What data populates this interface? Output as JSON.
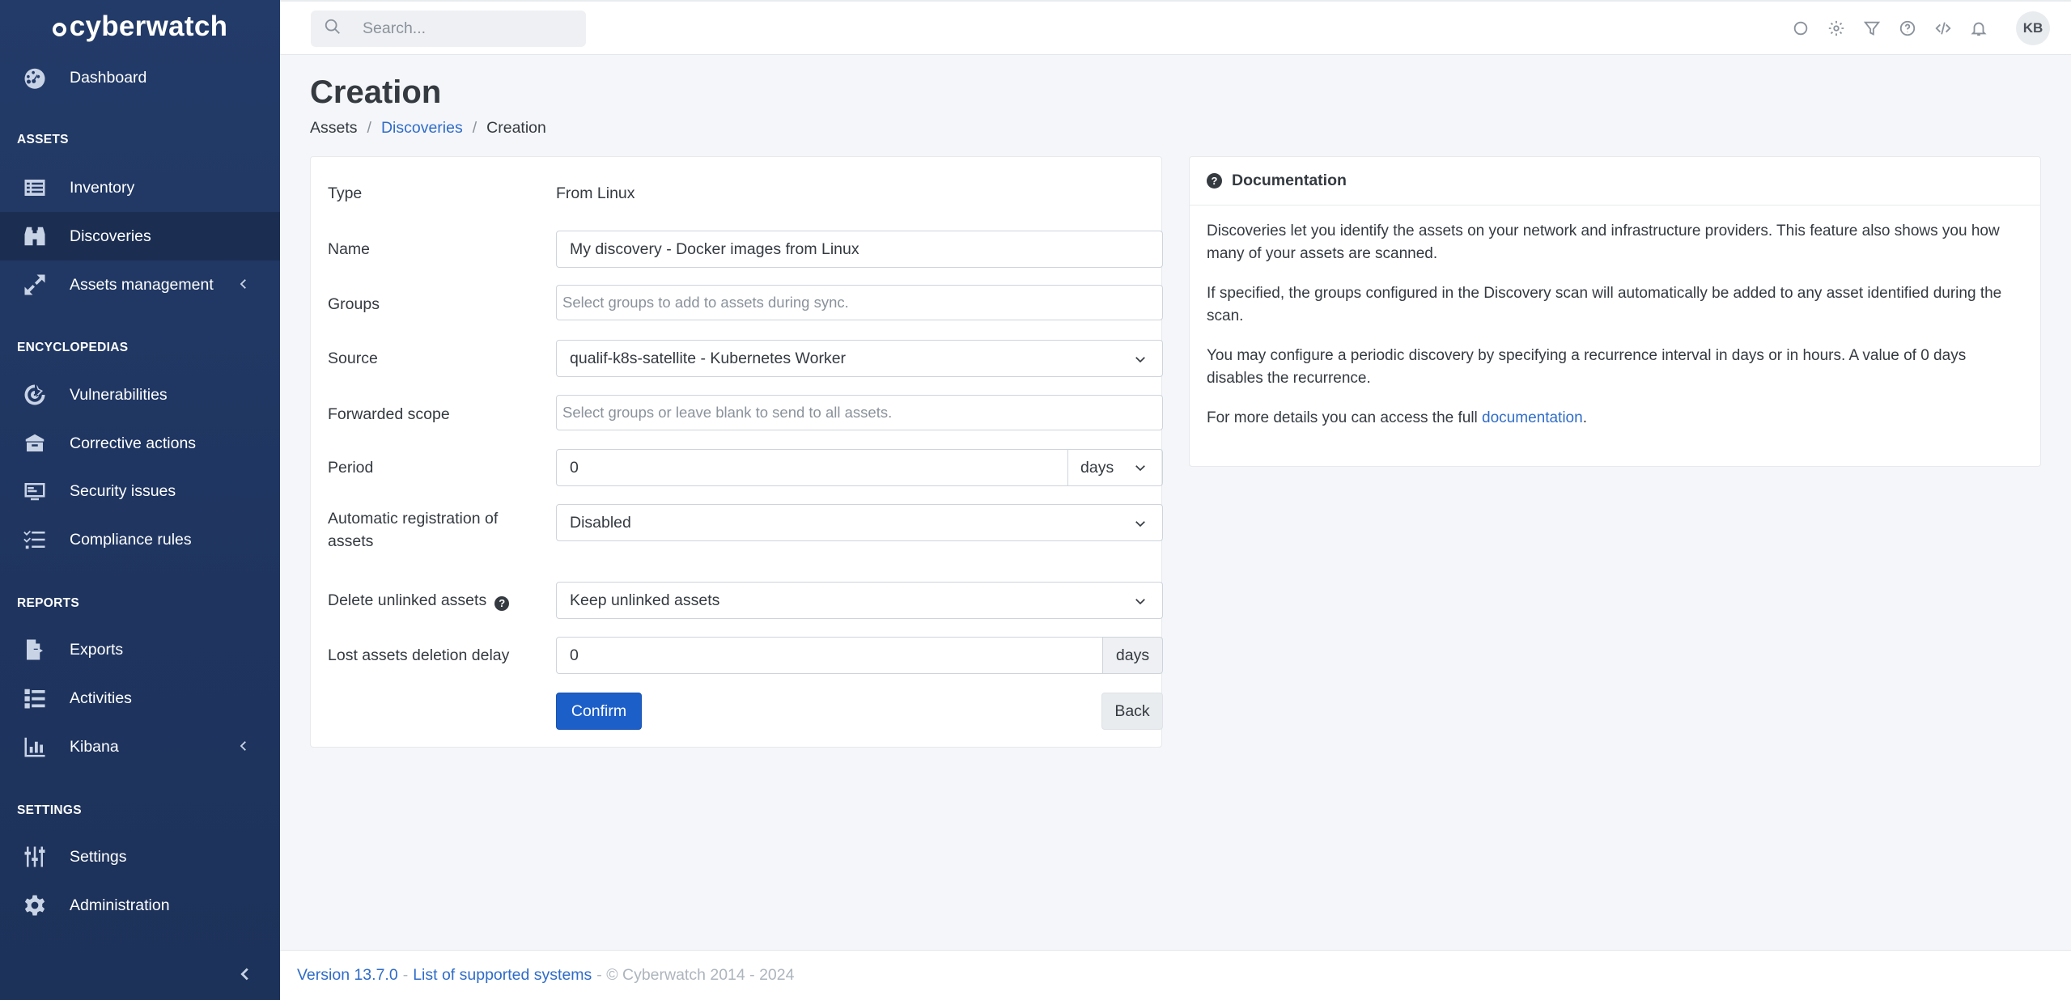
{
  "brand": {
    "name": "cyberwatch"
  },
  "search": {
    "placeholder": "Search..."
  },
  "user": {
    "initials": "KB"
  },
  "sidebar": {
    "sections": {
      "assets": "ASSETS",
      "encyclopedias": "ENCYCLOPEDIAS",
      "reports": "REPORTS",
      "settings": "SETTINGS"
    },
    "items": [
      {
        "label": "Dashboard",
        "icon": "dashboard-icon"
      },
      {
        "label": "Inventory",
        "icon": "inventory-icon"
      },
      {
        "label": "Discoveries",
        "icon": "binoculars-icon",
        "active": true
      },
      {
        "label": "Assets management",
        "icon": "expand-arrows-icon"
      },
      {
        "label": "Vulnerabilities",
        "icon": "target-icon"
      },
      {
        "label": "Corrective actions",
        "icon": "box-icon"
      },
      {
        "label": "Security issues",
        "icon": "screen-alert-icon"
      },
      {
        "label": "Compliance rules",
        "icon": "checklist-icon"
      },
      {
        "label": "Exports",
        "icon": "file-export-icon"
      },
      {
        "label": "Activities",
        "icon": "activities-list-icon"
      },
      {
        "label": "Kibana",
        "icon": "chart-bars-icon"
      },
      {
        "label": "Settings",
        "icon": "sliders-icon"
      },
      {
        "label": "Administration",
        "icon": "cog-icon"
      }
    ]
  },
  "page": {
    "title": "Creation",
    "breadcrumb": [
      "Assets",
      "Discoveries",
      "Creation"
    ]
  },
  "form": {
    "type": {
      "label": "Type",
      "value": "From Linux"
    },
    "name": {
      "label": "Name",
      "value": "My discovery - Docker images from Linux"
    },
    "groups": {
      "label": "Groups",
      "placeholder": "Select groups to add to assets during sync."
    },
    "source": {
      "label": "Source",
      "value": "qualif-k8s-satellite - Kubernetes Worker"
    },
    "forwarded_scope": {
      "label": "Forwarded scope",
      "placeholder": "Select groups or leave blank to send to all assets."
    },
    "period": {
      "label": "Period",
      "value": "0",
      "unit": "days"
    },
    "auto_registration": {
      "label": "Automatic registration of assets",
      "value": "Disabled"
    },
    "delete_unlinked": {
      "label": "Delete unlinked assets",
      "value": "Keep unlinked assets"
    },
    "lost_delay": {
      "label": "Lost assets deletion delay",
      "value": "0",
      "unit": "days"
    },
    "confirm_label": "Confirm",
    "back_label": "Back"
  },
  "documentation": {
    "title": "Documentation",
    "p1": "Discoveries let you identify the assets on your network and infrastructure providers. This feature also shows you how many of your assets are scanned.",
    "p2": "If specified, the groups configured in the Discovery scan will automatically be added to any asset identified during the scan.",
    "p3": "You may configure a periodic discovery by specifying a recurrence interval in days or in hours. A value of 0 days disables the recurrence.",
    "p4_prefix": "For more details you can access the full ",
    "p4_link": "documentation",
    "p4_suffix": "."
  },
  "footer": {
    "version": "Version 13.7.0",
    "sep1": "-",
    "systems_link": "List of supported systems",
    "copyright": "- © Cyberwatch 2014 - 2024"
  },
  "colors": {
    "sidebar": "#233b68",
    "accent": "#1d5fc9",
    "link": "#2f6cc8"
  }
}
